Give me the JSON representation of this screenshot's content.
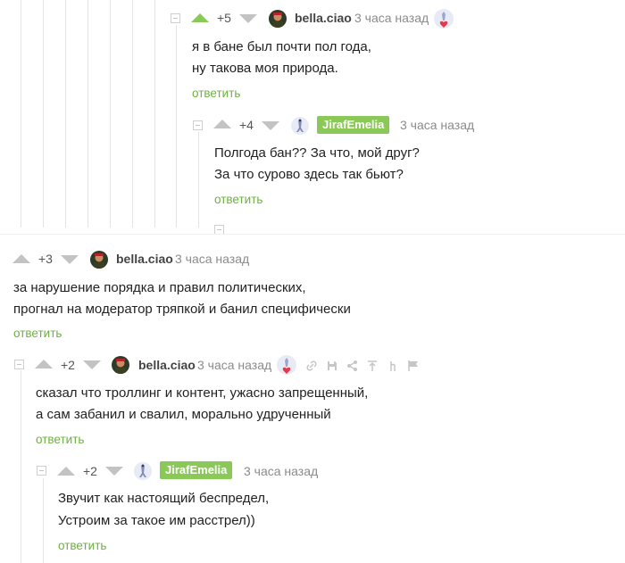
{
  "comments": [
    {
      "rating": "+5",
      "username": "bella.ciao",
      "time": "3 часа назад",
      "lines": [
        "я в бане был почти пол года,",
        "ну такова моя природа."
      ],
      "reply": "ответить"
    },
    {
      "rating": "+4",
      "username": "JirafEmelia",
      "time": "3 часа назад",
      "lines": [
        "Полгода бан?? За что, мой друг?",
        "За что сурово здесь так бьют?"
      ],
      "reply": "ответить"
    },
    {
      "rating": "+3",
      "username": "bella.ciao",
      "time": "3 часа назад",
      "lines": [
        "за нарушение порядка и правил политических,",
        "прогнал на модератор тряпкой и банил специфически"
      ],
      "reply": "ответить"
    },
    {
      "rating": "+2",
      "username": "bella.ciao",
      "time": "3 часа назад",
      "lines": [
        "сказал что троллинг и контент, ужасно запрещенный,",
        "а сам забанил и свалил, морально удрученный"
      ],
      "reply": "ответить"
    },
    {
      "rating": "+2",
      "username": "JirafEmelia",
      "time": "3 часа назад",
      "lines": [
        "Звучит как настоящий беспредел,",
        "Устроим за такое им расстрел))"
      ],
      "reply": "ответить"
    }
  ],
  "colors": {
    "accent_green": "#8ac858",
    "reply_green": "#6fb043",
    "muted_gray": "#8b8b8b"
  },
  "icons": [
    "collapse-icon",
    "upvote-icon",
    "downvote-icon",
    "link-icon",
    "save-icon",
    "share-icon",
    "go-to-parent-icon",
    "branch-icon",
    "report-flag-icon",
    "sticker-icon"
  ]
}
